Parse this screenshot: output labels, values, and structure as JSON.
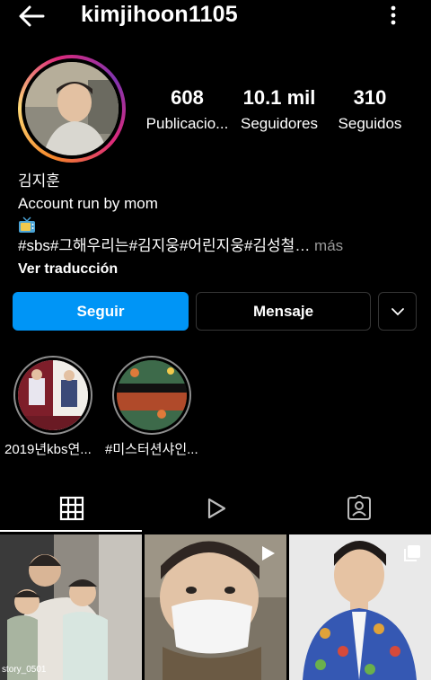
{
  "header": {
    "username": "kimjihoon1105",
    "back_icon": "arrow-left-icon",
    "more_icon": "more-vertical-icon"
  },
  "stats": {
    "posts": {
      "value": "608",
      "label": "Publicacio..."
    },
    "followers": {
      "value": "10.1 mil",
      "label": "Seguidores"
    },
    "following": {
      "value": "310",
      "label": "Seguidos"
    }
  },
  "bio": {
    "name": "김지훈",
    "line1": "Account run by mom",
    "emoji": "tv-icon",
    "tags": "#sbs#그해우리는#김지웅#어린지웅#김성철…",
    "more": " más",
    "translate": "Ver traducción"
  },
  "actions": {
    "follow": "Seguir",
    "message": "Mensaje",
    "dropdown_icon": "chevron-down-icon"
  },
  "highlights": [
    {
      "label": "2019년kbs연..."
    },
    {
      "label": "#미스터션샤인..."
    }
  ],
  "tabs": {
    "grid_icon": "grid-icon",
    "reels_icon": "reels-icon",
    "tagged_icon": "tagged-person-icon"
  },
  "posts": {
    "post1_caption": "story_0501"
  },
  "colors": {
    "accent": "#0095f6",
    "background": "#000000",
    "border": "#363636"
  }
}
